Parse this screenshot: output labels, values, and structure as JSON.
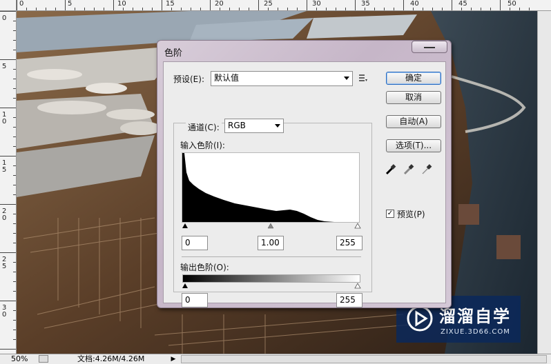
{
  "ruler": {
    "top_labels": [
      "0",
      "5",
      "10",
      "15",
      "20",
      "25",
      "30",
      "35",
      "40",
      "45",
      "50"
    ],
    "left_labels": [
      "0",
      "5",
      "1\n0",
      "1\n5",
      "2\n0",
      "2\n5",
      "3\n0"
    ]
  },
  "dialog": {
    "title": "色阶",
    "preset_label": "预设(E):",
    "preset_value": "默认值",
    "channel_label": "通道(C):",
    "channel_value": "RGB",
    "input_levels_label": "输入色阶(I):",
    "input_black": "0",
    "input_gamma": "1.00",
    "input_white": "255",
    "output_levels_label": "输出色阶(O):",
    "output_black": "0",
    "output_white": "255",
    "buttons": {
      "ok": "确定",
      "cancel": "取消",
      "auto": "自动(A)",
      "options": "选项(T)..."
    },
    "preview_label": "预览(P)",
    "preview_checked": true
  },
  "statusbar": {
    "zoom": "50%",
    "doc_info": "文档:4.26M/4.26M"
  },
  "watermark": {
    "title": "溜溜自学",
    "url": "ZIXUE.3D66.COM"
  },
  "icon_names": [
    "close-icon",
    "preset-menu-icon",
    "black-eyedropper-icon",
    "gray-eyedropper-icon",
    "white-eyedropper-icon",
    "play-logo-icon"
  ]
}
